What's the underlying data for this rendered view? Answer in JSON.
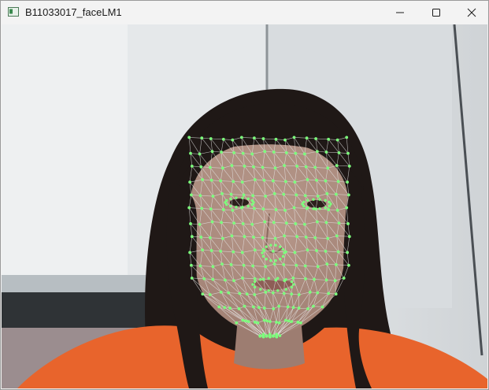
{
  "window": {
    "title": "B11033017_faceLM1",
    "app_icon": "opencv-window-icon",
    "controls": {
      "minimize_icon": "minimize-icon",
      "maximize_icon": "maximize-icon",
      "close_icon": "close-icon"
    }
  },
  "viewport": {
    "content": "webcam-frame-with-face-landmark-mesh",
    "mesh_color": "#7dff7d",
    "shirt_color": "#e8642c"
  }
}
